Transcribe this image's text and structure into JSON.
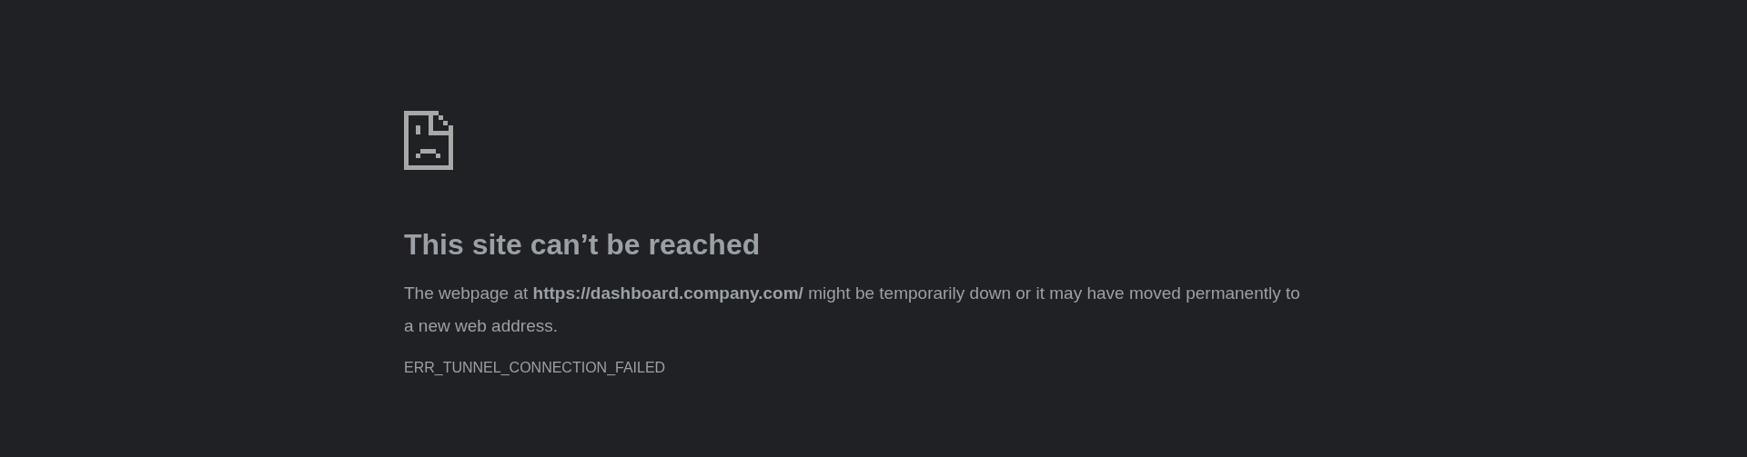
{
  "error_page": {
    "heading": "This site can’t be reached",
    "message": "The webpage at **https://dashboard.company.com/** might be temporarily down or it may have moved permanently to a new web address.",
    "error_code": "ERR_TUNNEL_CONNECTION_FAILED"
  }
}
